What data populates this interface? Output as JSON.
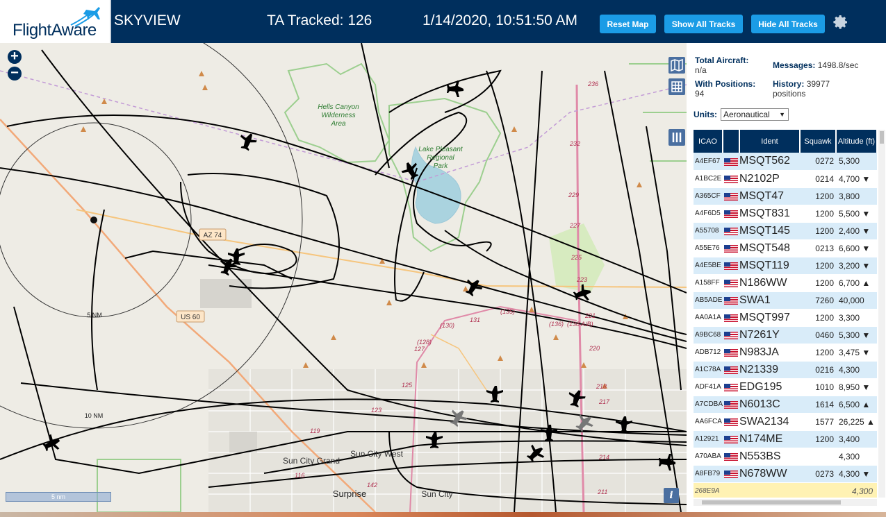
{
  "header": {
    "logo": "FlightAware",
    "site_name": "SKYVIEW",
    "ta_tracked": "TA Tracked: 126",
    "timestamp": "1/14/2020, 10:51:50 AM",
    "reset_map": "Reset Map",
    "show_all_tracks": "Show All Tracks",
    "hide_all_tracks": "Hide All Tracks",
    "settings_icon": "gear-icon"
  },
  "map": {
    "zoom_in": "+",
    "zoom_out": "−",
    "scale": "5 nm",
    "info": "i",
    "labels": {
      "hells_canyon_1": "Hells Canyon",
      "hells_canyon_2": "Wilderness",
      "hells_canyon_3": "Area",
      "lake_1": "Lake Pleasant",
      "lake_2": "Regional",
      "lake_3": "Park",
      "az74": "AZ 74",
      "us60": "US 60",
      "nm5": "5 NM",
      "nm10": "10 NM",
      "sun_city_grand": "Sun City Grand",
      "sun_city_west": "Sun City West",
      "surprise": "Surprise",
      "sun_city": "Sun City",
      "r236": "236",
      "r232": "232",
      "r229": "229",
      "r227": "227",
      "r225": "225",
      "r223": "223",
      "r221": "221",
      "r220": "220",
      "r218": "218",
      "r217": "217",
      "r214": "214",
      "r211": "211",
      "r131": "131",
      "r130": "(130)",
      "r135": "(135)",
      "r136": "(136)",
      "r138": "(138 A/B)",
      "r128": "(128)",
      "r127": "127",
      "r125": "125",
      "r123": "123",
      "r119": "119",
      "r116": "116",
      "r142": "142"
    },
    "ctrl_icons": [
      "map-icon",
      "grid-icon",
      "columns-icon"
    ]
  },
  "sidebar": {
    "total_aircraft_label": "Total Aircraft:",
    "total_aircraft_value": "n/a",
    "with_positions_label": "With Positions:",
    "with_positions_value": "94",
    "messages_label": "Messages:",
    "messages_value": "1498.8/sec",
    "history_label": "History:",
    "history_value": "39977",
    "history_unit": "positions",
    "units_label": "Units:",
    "units_value": "Aeronautical"
  },
  "table": {
    "headers": [
      "ICAO",
      "",
      "Ident",
      "Squawk",
      "Altitude (ft)"
    ],
    "rows": [
      {
        "icao": "A4EF67",
        "ident": "MSQT562",
        "squawk": "0272",
        "alt": "5,300",
        "trend": ""
      },
      {
        "icao": "A1BC2E",
        "ident": "N2102P",
        "squawk": "0214",
        "alt": "4,700",
        "trend": "▼"
      },
      {
        "icao": "A365CF",
        "ident": "MSQT47",
        "squawk": "1200",
        "alt": "3,800",
        "trend": ""
      },
      {
        "icao": "A4F6D5",
        "ident": "MSQT831",
        "squawk": "1200",
        "alt": "5,500",
        "trend": "▼"
      },
      {
        "icao": "A55708",
        "ident": "MSQT145",
        "squawk": "1200",
        "alt": "2,400",
        "trend": "▼"
      },
      {
        "icao": "A55E76",
        "ident": "MSQT548",
        "squawk": "0213",
        "alt": "6,600",
        "trend": "▼"
      },
      {
        "icao": "A4E5BE",
        "ident": "MSQT119",
        "squawk": "1200",
        "alt": "3,200",
        "trend": "▼"
      },
      {
        "icao": "A158FF",
        "ident": "N186WW",
        "squawk": "1200",
        "alt": "6,700",
        "trend": "▲"
      },
      {
        "icao": "AB5ADE",
        "ident": "SWA1",
        "squawk": "7260",
        "alt": "40,000",
        "trend": ""
      },
      {
        "icao": "AA0A1A",
        "ident": "MSQT997",
        "squawk": "1200",
        "alt": "3,300",
        "trend": ""
      },
      {
        "icao": "A9BC68",
        "ident": "N7261Y",
        "squawk": "0460",
        "alt": "5,300",
        "trend": "▼"
      },
      {
        "icao": "ADB712",
        "ident": "N983JA",
        "squawk": "1200",
        "alt": "3,475",
        "trend": "▼"
      },
      {
        "icao": "A1C78A",
        "ident": "N21339",
        "squawk": "0216",
        "alt": "4,300",
        "trend": ""
      },
      {
        "icao": "ADF41A",
        "ident": "EDG195",
        "squawk": "1010",
        "alt": "8,950",
        "trend": "▼"
      },
      {
        "icao": "A7CDBA",
        "ident": "N6013C",
        "squawk": "1614",
        "alt": "6,500",
        "trend": "▲"
      },
      {
        "icao": "AA6FCA",
        "ident": "SWA2134",
        "squawk": "1577",
        "alt": "26,225",
        "trend": "▲"
      },
      {
        "icao": "A12921",
        "ident": "N174ME",
        "squawk": "1200",
        "alt": "3,400",
        "trend": ""
      },
      {
        "icao": "A70ABA",
        "ident": "N553BS",
        "squawk": "",
        "alt": "4,300",
        "trend": ""
      },
      {
        "icao": "A8FB79",
        "ident": "N678WW",
        "squawk": "0273",
        "alt": "4,300",
        "trend": "▼"
      }
    ],
    "selected_row": {
      "icao": "268E9A",
      "ident": "",
      "squawk": "",
      "alt": "4,300"
    }
  }
}
